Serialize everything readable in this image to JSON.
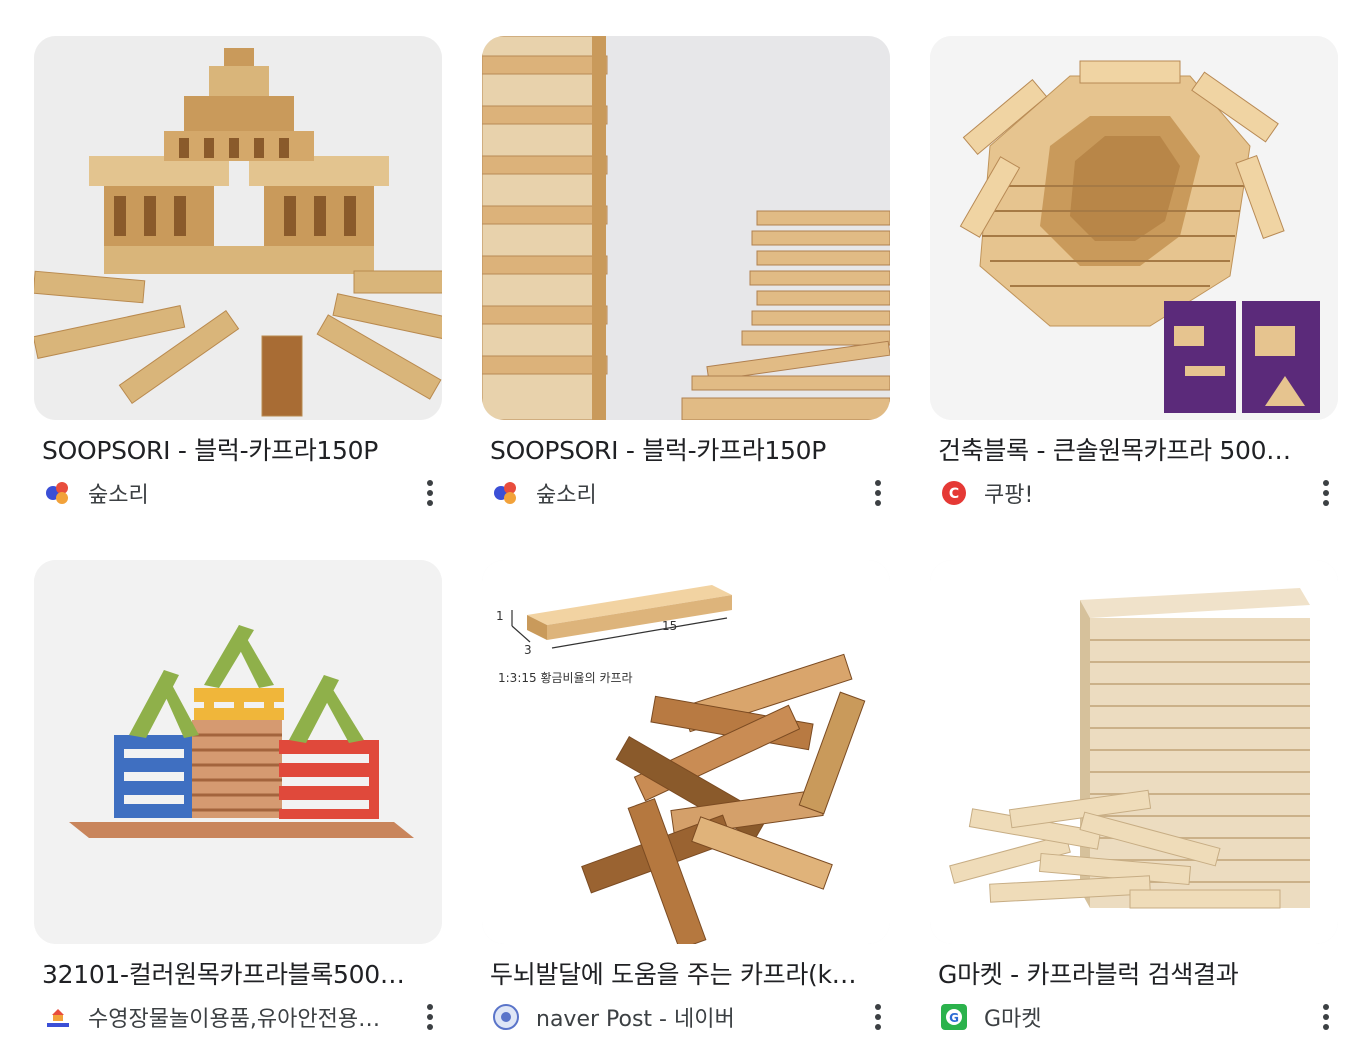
{
  "results": [
    {
      "title": "SOOPSORI - 블럭-카프라150P",
      "source": "숲소리",
      "favicon": "soopsori-logo-icon"
    },
    {
      "title": "SOOPSORI - 블럭-카프라150P",
      "source": "숲소리",
      "favicon": "soopsori-logo-icon"
    },
    {
      "title": "건축블록 - 큰솔원목카프라 500…",
      "source": "쿠팡!",
      "favicon": "coupang-logo-icon"
    },
    {
      "title": "32101-컬러원목카프라블록500…",
      "source": "수영장물놀이용품,유아안전용…",
      "favicon": "store-logo-icon"
    },
    {
      "title": "두뇌발달에 도움을 주는 카프라(k…",
      "source": "naver Post - 네이버",
      "favicon": "naver-post-logo-icon"
    },
    {
      "title": "G마켓 - 카프라블럭 검색결과",
      "source": "G마켓",
      "favicon": "gmarket-logo-icon"
    }
  ],
  "image_labels": {
    "dimension_1": "1",
    "dimension_3": "3",
    "dimension_15": "15",
    "ratio_caption": "1:3:15 황금비율의 카프라"
  },
  "colors": {
    "wood_light": "#e3c48f",
    "wood_mid": "#c99a5b",
    "wood_dark": "#8a5a2b",
    "coupang_red": "#e53935",
    "gmarket_green": "#2bb24c"
  }
}
